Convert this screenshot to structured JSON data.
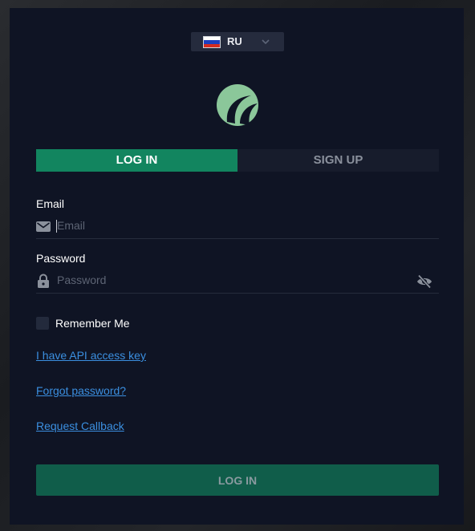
{
  "language": {
    "code": "RU",
    "flag_colors": [
      "#ffffff",
      "#1c3fbf",
      "#d52b1e"
    ],
    "icon": "chevron-down-icon"
  },
  "logo": {
    "icon": "brand-logo-icon",
    "color": "#8bc79a"
  },
  "tabs": [
    {
      "label": "LOG IN",
      "active": true
    },
    {
      "label": "SIGN UP",
      "active": false
    }
  ],
  "email": {
    "label": "Email",
    "placeholder": "Email",
    "value": "",
    "icon": "envelope-icon"
  },
  "password": {
    "label": "Password",
    "placeholder": "Password",
    "value": "",
    "icon": "lock-icon",
    "toggle_icon": "eye-slash-icon"
  },
  "remember": {
    "label": "Remember Me",
    "checked": false
  },
  "links": {
    "api_key": "I have API access key",
    "forgot": "Forgot password?",
    "callback": "Request Callback"
  },
  "submit_label": "LOG IN",
  "colors": {
    "accent": "#12855f",
    "submit_bg": "#105d4a",
    "panel_bg": "#0f1424",
    "link": "#3b8fe0"
  }
}
